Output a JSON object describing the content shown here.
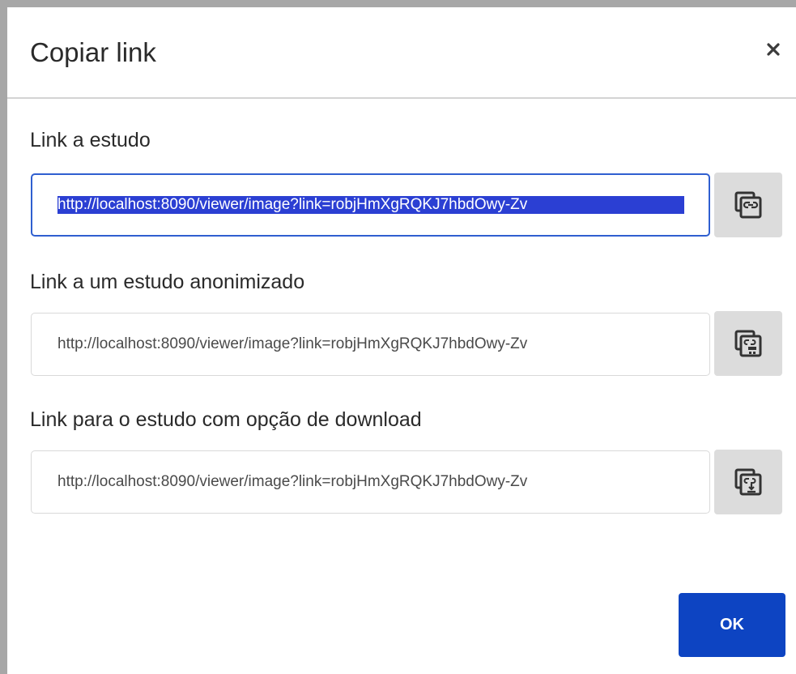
{
  "dialog": {
    "title": "Copiar link",
    "close_icon": "close-icon"
  },
  "links": [
    {
      "label": "Link a estudo",
      "value": "http://localhost:8090/viewer/image?link=robjHmXgRQKJ7hbdOwy-Zv",
      "selected": true,
      "icon": "copy-link-icon"
    },
    {
      "label": "Link a um estudo anonimizado",
      "value": "http://localhost:8090/viewer/image?link=robjHmXgRQKJ7hbdOwy-Zv",
      "selected": false,
      "icon": "copy-anonymized-link-icon"
    },
    {
      "label": "Link para o estudo com opção de download",
      "value": "http://localhost:8090/viewer/image?link=robjHmXgRQKJ7hbdOwy-Zv",
      "selected": false,
      "icon": "copy-download-link-icon"
    }
  ],
  "footer": {
    "ok_label": "OK"
  },
  "colors": {
    "primary": "#0d44c2",
    "selection": "#2b3fd3",
    "focus_border": "#2f5fd0"
  }
}
